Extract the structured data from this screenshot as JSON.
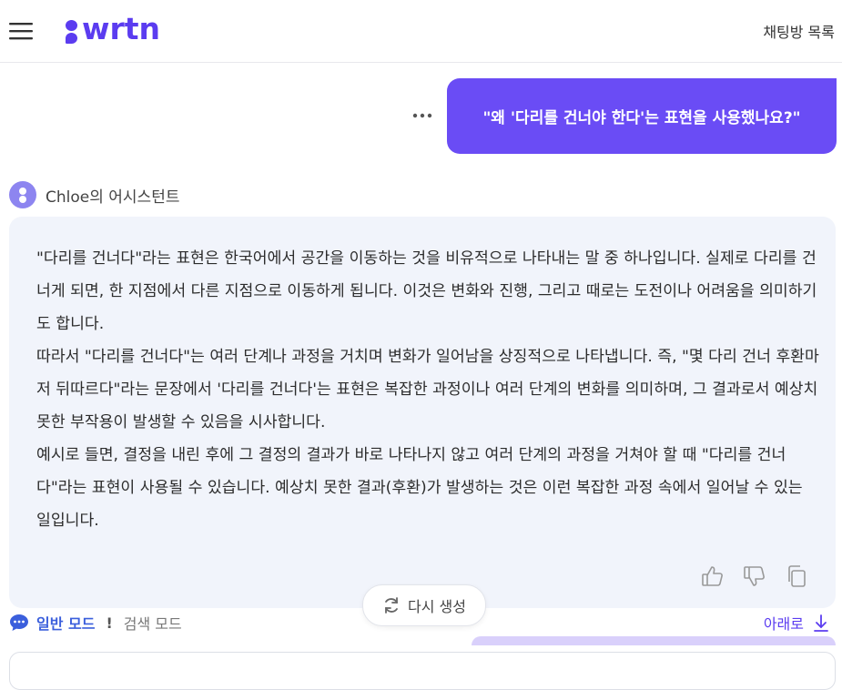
{
  "header": {
    "logo_text": "wrtn",
    "chat_list_label": "채팅방 목록",
    "menu_icon": "hamburger-menu-icon"
  },
  "user_message": {
    "text": "\"왜 '다리를 건너야 한다'는 표현을 사용했나요?\"",
    "more_icon": "more-dots-icon"
  },
  "assistant": {
    "name": "Chloe의 어시스턴트",
    "paragraphs": [
      "\"다리를 건너다\"라는 표현은 한국어에서 공간을 이동하는 것을 비유적으로 나타내는 말 중 하나입니다. 실제로 다리를 건너게 되면, 한 지점에서 다른 지점으로 이동하게 됩니다. 이것은 변화와 진행, 그리고 때로는 도전이나 어려움을 의미하기도 합니다.",
      "따라서 \"다리를 건너다\"는 여러 단계나 과정을 거치며 변화가 일어남을 상징적으로 나타냅니다. 즉, \"몇 다리 건너 후환마저 뒤따르다\"라는 문장에서 '다리를 건너다'는 표현은 복잡한 과정이나 여러 단계의 변화를 의미하며, 그 결과로서 예상치 못한 부작용이 발생할 수 있음을 시사합니다.",
      "예시로 들면, 결정을 내린 후에 그 결정의 결과가 바로 나타나지 않고 여러 단계의 과정을 거쳐야 할 때 \"다리를 건너다\"라는 표현이 사용될 수 있습니다. 예상치 못한 결과(후환)가 발생하는 것은 이런 복잡한 과정 속에서 일어날 수 있는 일입니다."
    ],
    "actions": [
      "thumbs-up-icon",
      "thumbs-down-icon",
      "copy-icon"
    ]
  },
  "controls": {
    "regenerate_label": "다시 생성",
    "mode_general": "일반 모드",
    "mode_separator": "!",
    "mode_search": "검색 모드",
    "scroll_down_label": "아래로"
  },
  "colors": {
    "brand": "#5b3cf0",
    "user_bubble": "#6a4cf5",
    "card_bg": "#f1f4fb",
    "mode_active": "#3b5fdc"
  }
}
